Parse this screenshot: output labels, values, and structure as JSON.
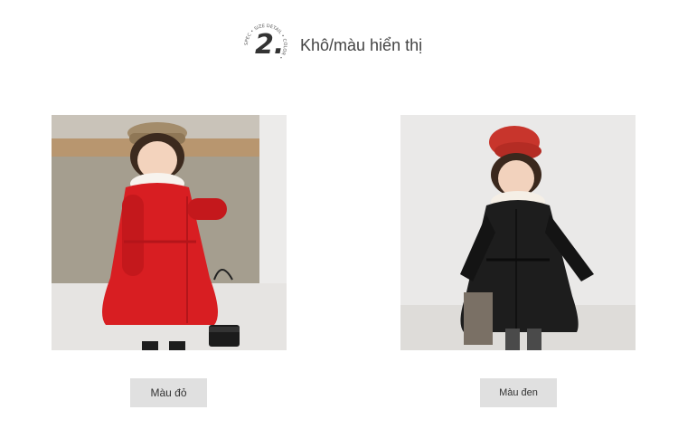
{
  "header": {
    "step_number": "2.",
    "badge_ring_text": "SPEC • SIZE DETAIL • COLOR •",
    "title": "Khô/màu hiển thị"
  },
  "swatches": [
    {
      "label": "Màu đỏ",
      "color": "#d81e22",
      "photo_icon": "girl-red-coat-image"
    },
    {
      "label": "Màu đen",
      "color": "#1b1b1b",
      "photo_icon": "girl-black-coat-image"
    }
  ]
}
